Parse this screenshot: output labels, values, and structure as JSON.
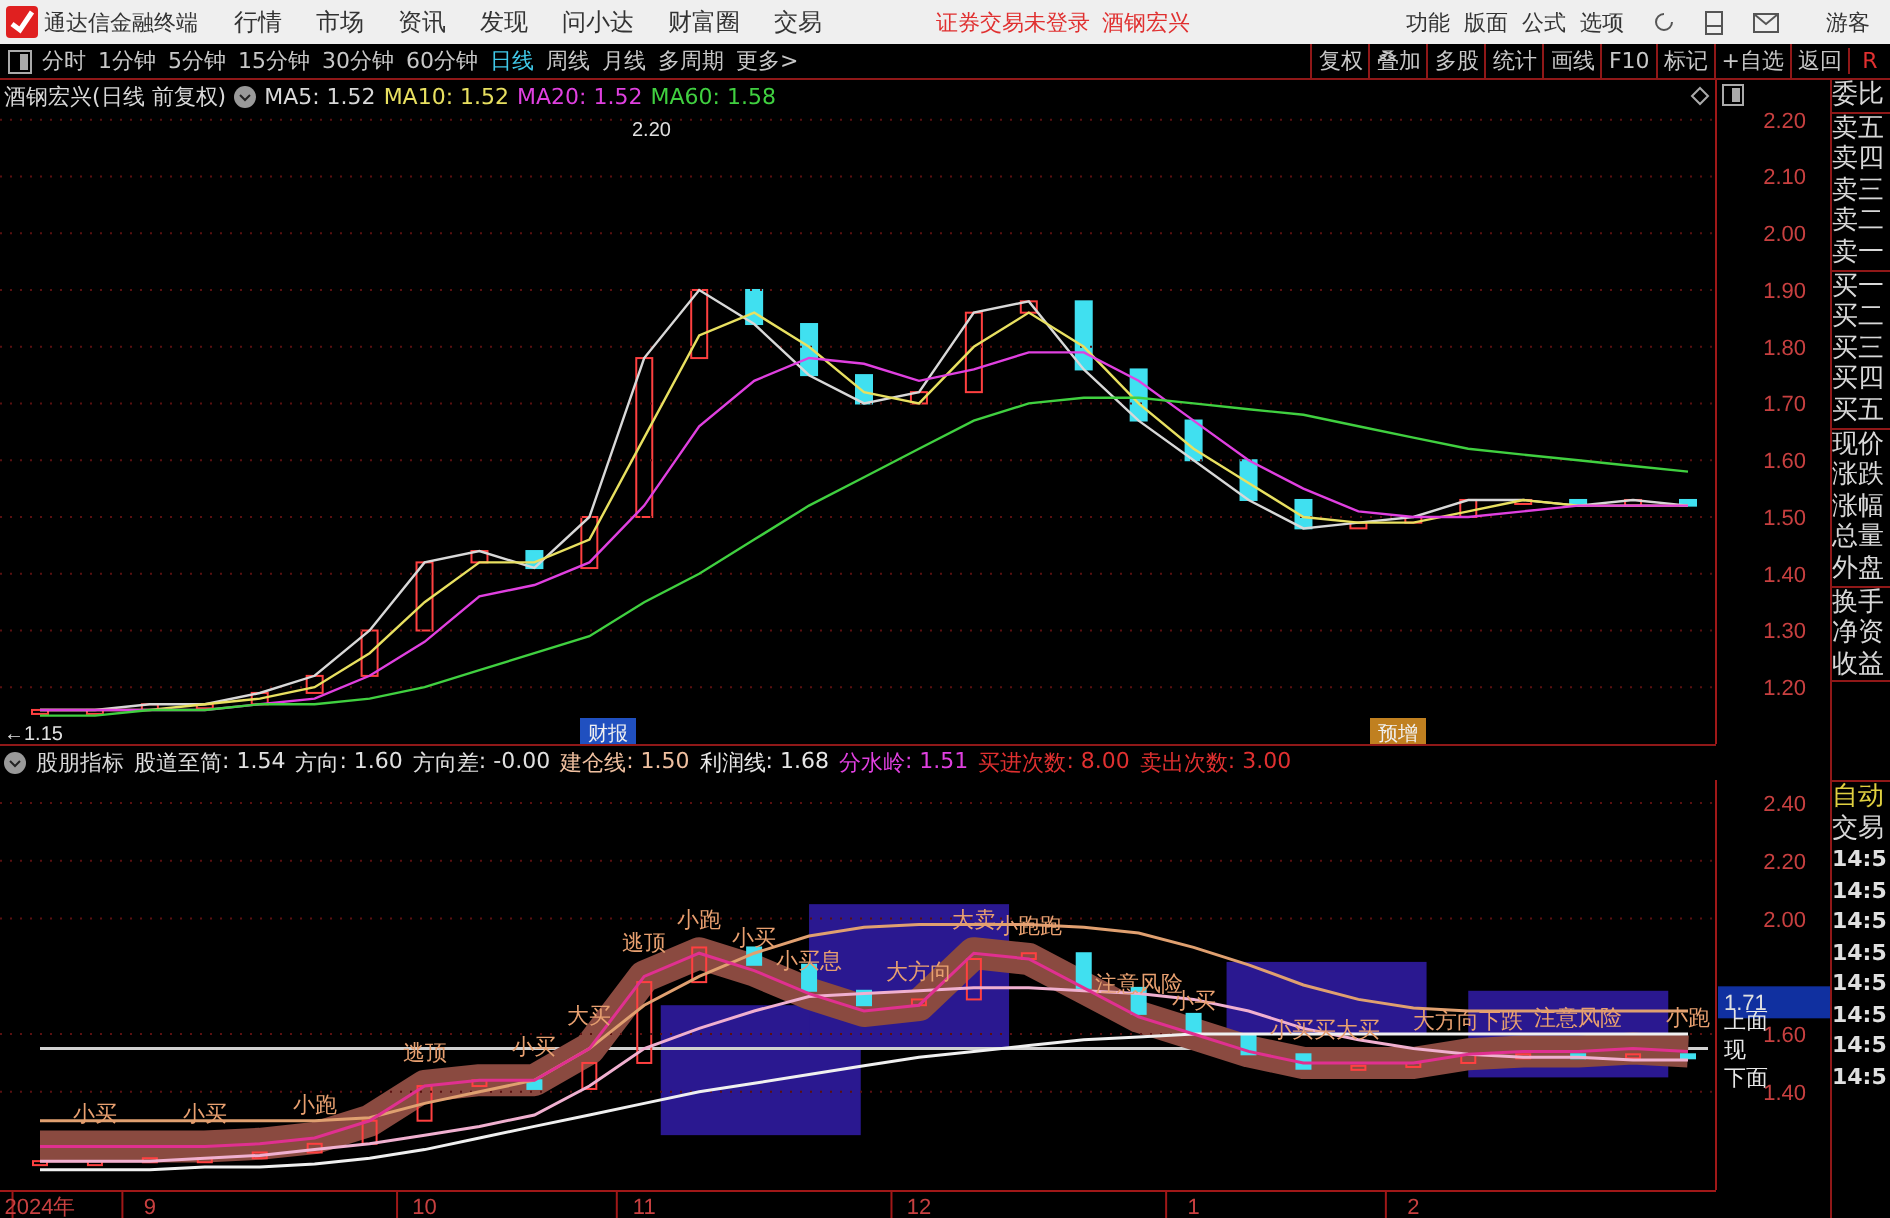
{
  "menubar": {
    "app_title": "通达信金融终端",
    "menus": [
      "行情",
      "市场",
      "资讯",
      "发现",
      "问小达",
      "财富圈",
      "交易"
    ],
    "status": "证券交易未登录",
    "stock": "酒钢宏兴",
    "right_menus": [
      "功能",
      "版面",
      "公式",
      "选项"
    ],
    "user": "游客"
  },
  "toolbar": {
    "periods": [
      {
        "label": "分时",
        "selected": false
      },
      {
        "label": "1分钟",
        "selected": false
      },
      {
        "label": "5分钟",
        "selected": false
      },
      {
        "label": "15分钟",
        "selected": false
      },
      {
        "label": "30分钟",
        "selected": false
      },
      {
        "label": "60分钟",
        "selected": false
      },
      {
        "label": "日线",
        "selected": true
      },
      {
        "label": "周线",
        "selected": false
      },
      {
        "label": "月线",
        "selected": false
      },
      {
        "label": "多周期",
        "selected": false
      },
      {
        "label": "更多>",
        "selected": false
      }
    ],
    "actions": [
      "复权",
      "叠加",
      "多股",
      "统计",
      "画线",
      "F10",
      "标记",
      "+自选",
      "返回"
    ],
    "corner": "R"
  },
  "main_chart": {
    "title": "酒钢宏兴(日线 前复权)",
    "legend_values": [
      ": 1.52",
      ": 1.52",
      ": 1.52",
      ": 1.58"
    ],
    "price_marks": [
      "2.20",
      "←1.15"
    ],
    "events": [
      {
        "text": "财报",
        "color": "#2050c0"
      },
      {
        "text": "预增",
        "color": "#c08020"
      }
    ],
    "chart_data": {
      "type": "line",
      "grid": true,
      "categories": [
        null,
        null,
        null,
        null,
        null,
        null,
        null,
        null,
        null,
        null,
        null,
        null,
        null,
        null,
        null,
        null,
        null,
        null,
        null,
        null,
        null,
        null,
        null,
        null,
        null,
        null,
        null,
        null,
        null,
        null,
        null
      ],
      "ylim": [
        1.1,
        2.27
      ],
      "yticks": [
        {
          "value": 2.2,
          "label": "2.20"
        },
        {
          "value": 2.1,
          "label": "2.10"
        },
        {
          "value": 2.0,
          "label": "2.00"
        },
        {
          "value": 1.9,
          "label": "1.90"
        },
        {
          "value": 1.8,
          "label": "1.80"
        },
        {
          "value": 1.7,
          "label": "1.70"
        },
        {
          "value": 1.6,
          "label": "1.60"
        },
        {
          "value": 1.5,
          "label": "1.50"
        },
        {
          "value": 1.4,
          "label": "1.40"
        },
        {
          "value": 1.3,
          "label": "1.30"
        },
        {
          "value": 1.2,
          "label": "1.20"
        }
      ],
      "series": [
        {
          "name": "MA5",
          "color": "#d8d8d8",
          "values": [
            1.16,
            1.16,
            1.17,
            1.17,
            1.19,
            1.22,
            1.3,
            1.42,
            1.44,
            1.41,
            1.5,
            1.78,
            1.9,
            1.84,
            1.75,
            1.7,
            1.72,
            1.86,
            1.88,
            1.76,
            1.67,
            1.6,
            1.53,
            1.48,
            1.49,
            1.5,
            1.53,
            1.53,
            1.52,
            1.53,
            1.52
          ]
        },
        {
          "name": "MA10",
          "color": "#e8e060",
          "values": [
            1.16,
            1.16,
            1.16,
            1.17,
            1.18,
            1.2,
            1.26,
            1.35,
            1.42,
            1.42,
            1.46,
            1.64,
            1.82,
            1.86,
            1.8,
            1.72,
            1.7,
            1.8,
            1.86,
            1.8,
            1.7,
            1.62,
            1.56,
            1.5,
            1.49,
            1.49,
            1.51,
            1.53,
            1.52,
            1.52,
            1.52
          ]
        },
        {
          "name": "MA20",
          "color": "#e040e0",
          "values": [
            1.16,
            1.16,
            1.16,
            1.16,
            1.17,
            1.18,
            1.22,
            1.28,
            1.36,
            1.38,
            1.42,
            1.52,
            1.66,
            1.74,
            1.78,
            1.77,
            1.74,
            1.76,
            1.79,
            1.79,
            1.74,
            1.67,
            1.6,
            1.55,
            1.51,
            1.5,
            1.5,
            1.51,
            1.52,
            1.52,
            1.52
          ]
        },
        {
          "name": "MA60",
          "color": "#40d040",
          "values": [
            1.15,
            1.15,
            1.16,
            1.16,
            1.17,
            1.17,
            1.18,
            1.2,
            1.23,
            1.26,
            1.29,
            1.35,
            1.4,
            1.46,
            1.52,
            1.57,
            1.62,
            1.67,
            1.7,
            1.71,
            1.71,
            1.7,
            1.69,
            1.68,
            1.66,
            1.64,
            1.62,
            1.61,
            1.6,
            1.59,
            1.58
          ]
        }
      ]
    }
  },
  "indicator": {
    "title": "股朋指标",
    "header": [
      {
        "kind": "series",
        "value": ": 1.54",
        "color": "#e0e0e0"
      },
      {
        "kind": "series",
        "value": ": 1.60",
        "color": "#e0e0e0"
      },
      {
        "kind": "value",
        "label": "方向差",
        "value": ": -0.00",
        "color": "#e0e0e0"
      },
      {
        "kind": "value",
        "label": "建仓线",
        "value": ": 1.50",
        "color": "#f0c0a0"
      },
      {
        "kind": "series",
        "value": ": 1.68",
        "color": "#e8e8e8"
      },
      {
        "kind": "series",
        "value": ": 1.51",
        "color": "#e040e0"
      },
      {
        "kind": "value",
        "label": "买进次数",
        "value": ": 8.00",
        "color": "#e03030"
      },
      {
        "kind": "value",
        "label": "卖出次数",
        "value": ": 3.00",
        "color": "#e03030"
      }
    ],
    "cursor_price": "1.71",
    "level_labels": [
      "上面",
      "现",
      "下面"
    ],
    "chart_data": {
      "type": "line",
      "grid": true,
      "categories": [
        "2024年",
        null,
        "9",
        null,
        null,
        null,
        null,
        "10",
        null,
        null,
        null,
        "11",
        null,
        null,
        null,
        null,
        "12",
        null,
        null,
        null,
        null,
        "1",
        null,
        null,
        null,
        "2",
        null,
        null,
        null,
        null,
        null
      ],
      "ylim": [
        1.06,
        2.48
      ],
      "yticks": [
        {
          "value": 2.4,
          "label": "2.40"
        },
        {
          "value": 2.2,
          "label": "2.20"
        },
        {
          "value": 2.0,
          "label": "2.00"
        },
        {
          "value": 1.6,
          "label": "1.60"
        },
        {
          "value": 1.4,
          "label": "1.40"
        }
      ],
      "series": [
        {
          "name": "股道至简",
          "color": "#e03090",
          "values": [
            1.21,
            1.21,
            1.21,
            1.21,
            1.22,
            1.24,
            1.3,
            1.42,
            1.44,
            1.44,
            1.55,
            1.8,
            1.88,
            1.82,
            1.74,
            1.68,
            1.7,
            1.88,
            1.86,
            1.76,
            1.66,
            1.6,
            1.54,
            1.5,
            1.5,
            1.5,
            1.53,
            1.54,
            1.54,
            1.55,
            1.54
          ]
        },
        {
          "name": "方向",
          "color": "#f0f0f0",
          "values": [
            1.13,
            1.13,
            1.13,
            1.14,
            1.14,
            1.15,
            1.17,
            1.2,
            1.24,
            1.28,
            1.32,
            1.36,
            1.4,
            1.43,
            1.46,
            1.49,
            1.52,
            1.54,
            1.56,
            1.58,
            1.59,
            1.6,
            1.6,
            1.6,
            1.6,
            1.6,
            1.6,
            1.6,
            1.6,
            1.6,
            1.6
          ]
        },
        {
          "name": "利润线",
          "color": "#e0a070",
          "values": [
            1.3,
            1.3,
            1.3,
            1.3,
            1.3,
            1.3,
            1.31,
            1.36,
            1.4,
            1.44,
            1.55,
            1.7,
            1.8,
            1.88,
            1.94,
            1.97,
            1.98,
            1.98,
            1.98,
            1.97,
            1.95,
            1.9,
            1.84,
            1.77,
            1.72,
            1.69,
            1.68,
            1.68,
            1.68,
            1.68,
            1.68
          ]
        },
        {
          "name": "分水岭",
          "color": "#f0b0d0",
          "values": [
            1.16,
            1.16,
            1.16,
            1.17,
            1.18,
            1.2,
            1.22,
            1.25,
            1.28,
            1.32,
            1.42,
            1.55,
            1.62,
            1.68,
            1.73,
            1.74,
            1.75,
            1.76,
            1.76,
            1.75,
            1.74,
            1.72,
            1.68,
            1.62,
            1.58,
            1.55,
            1.53,
            1.52,
            1.52,
            1.51,
            1.51
          ]
        }
      ],
      "annotations": [
        "小买",
        "小买",
        "小跑",
        "逃顶",
        "小买",
        "大买",
        "逃顶",
        "小跑",
        "小买",
        "小买息",
        "大方向",
        "大卖",
        "小跑跑",
        "注意风险",
        "小买",
        "小买买",
        "大买",
        "大方向下跌",
        "注意风险",
        "小跑"
      ]
    }
  },
  "quote_panel": {
    "groups": [
      [
        "委比"
      ],
      [
        "卖五",
        "卖四",
        "卖三",
        "卖二",
        "卖一"
      ],
      [
        "买一",
        "买二",
        "买三",
        "买四",
        "买五"
      ],
      [
        "现价",
        "涨跌",
        "涨幅",
        "总量",
        "外盘"
      ],
      [
        "换手",
        "净资",
        "收益"
      ]
    ],
    "auto_label": "自动",
    "trade_label": "交易",
    "times": [
      "14:5",
      "14:5",
      "14:5",
      "14:5",
      "14:5",
      "14:5",
      "14:5",
      "14:5"
    ]
  }
}
